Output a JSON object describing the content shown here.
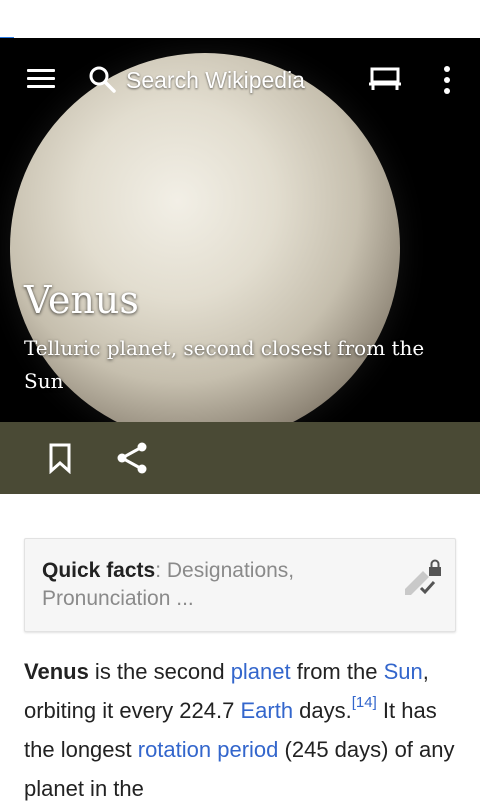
{
  "toolbar": {
    "search_placeholder": "Search Wikipedia",
    "icons": [
      "menu-icon",
      "search-icon",
      "reading-list-icon",
      "overflow-menu-icon"
    ]
  },
  "lead": {
    "title": "Venus",
    "description": "Telluric planet, second closest from the Sun",
    "image": "planet-venus"
  },
  "actions": {
    "icons": [
      "bookmark-icon",
      "share-icon"
    ]
  },
  "colors": {
    "action_bar": "#4a4a35",
    "link": "#3366cc",
    "load_indicator": "#2a7ae2"
  },
  "quick_facts": {
    "label": "Quick facts",
    "separator": ": ",
    "summary": "Designations, Pronunciation ..."
  },
  "body": {
    "bold_term": "Venus",
    "t1": " is the second ",
    "link_planet": "planet",
    "t2": " from the ",
    "link_sun": "Sun",
    "t3": ", orbiting it every 224.7 ",
    "link_earth": "Earth",
    "t4": " days.",
    "ref": "[14]",
    "t5": " It has the longest ",
    "link_rotation": "rotation period",
    "t6": " (245 days) of any planet in the"
  }
}
